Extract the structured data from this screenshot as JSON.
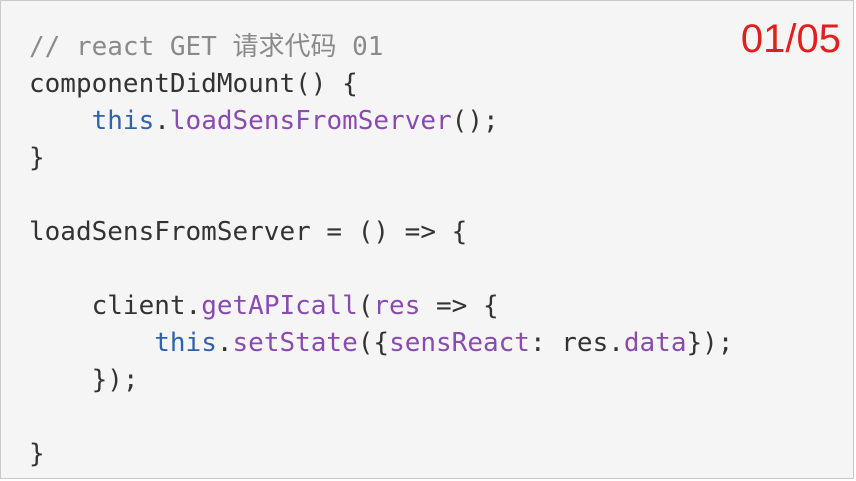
{
  "page_indicator": "01/05",
  "colors": {
    "background": "#f5f5f5",
    "indicator": "#e0201f",
    "comment": "#8a8a8a",
    "keyword": "#2f63b0",
    "function": "#8a4bb0",
    "text": "#333333"
  },
  "code": {
    "line1": {
      "comment": "// react GET 请求代码 01"
    },
    "line2": {
      "text": "componentDidMount() {"
    },
    "line3": {
      "indent": "    ",
      "kw": "this",
      "dot": ".",
      "fn": "loadSensFromServer",
      "rest": "();"
    },
    "line4": {
      "text": "}"
    },
    "line5": {
      "text": ""
    },
    "line6": {
      "text": "loadSensFromServer = () => {"
    },
    "line7": {
      "text": ""
    },
    "line8": {
      "indent": "    ",
      "obj": "client.",
      "fn": "getAPIcall",
      "paren": "(",
      "arg": "res",
      "rest": " => {"
    },
    "line9": {
      "indent": "        ",
      "kw": "this",
      "dot": ".",
      "fn": "setState",
      "open": "({",
      "key": "sensReact",
      "colon": ": res.",
      "prop": "data",
      "close": "});"
    },
    "line10": {
      "text": "    });"
    },
    "line11": {
      "text": ""
    },
    "line12": {
      "text": "}"
    }
  }
}
